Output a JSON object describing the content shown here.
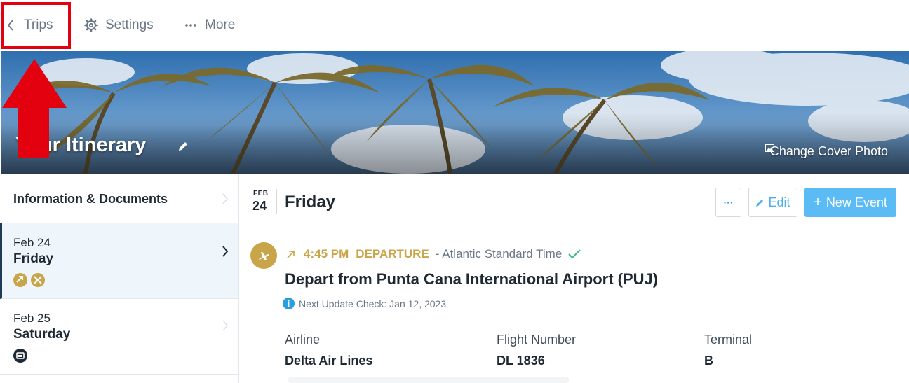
{
  "nav": {
    "back_label": "Trips",
    "settings_label": "Settings",
    "more_label": "More",
    "icons": [
      "chevron-left-icon",
      "gear-icon",
      "ellipsis-icon"
    ]
  },
  "hero": {
    "title": "Your Itinerary",
    "change_cover_label": "Change Cover Photo",
    "icons": [
      "pencil-icon",
      "image-icon"
    ]
  },
  "sidebar": {
    "info_label": "Information & Documents",
    "days": [
      {
        "date": "Feb 24",
        "weekday": "Friday",
        "icons": [
          "flight-icon",
          "flight-icon"
        ],
        "active": true
      },
      {
        "date": "Feb 25",
        "weekday": "Saturday",
        "icons": [
          "lodging-icon"
        ],
        "active": false
      }
    ]
  },
  "main": {
    "date_month": "FEB",
    "date_day": "24",
    "day_title": "Friday",
    "more_button": "···",
    "edit_button": "Edit",
    "new_event_button": "New Event",
    "new_event_plus": "+",
    "event": {
      "time": "4:45 PM",
      "kind": "DEPARTURE",
      "timezone": "- Atlantic Standard Time",
      "title": "Depart from Punta Cana International Airport (PUJ)",
      "update": "Next Update Check: Jan 12, 2023",
      "fields": [
        {
          "label": "Airline",
          "value": "Delta Air Lines"
        },
        {
          "label": "Flight Number",
          "value": "DL 1836"
        },
        {
          "label": "Terminal",
          "value": "B"
        }
      ]
    }
  },
  "colors": {
    "accent": "#5bbcf5",
    "gold": "#c9a54a",
    "annotation_red": "#e3000f",
    "status_green": "#3fbf7f"
  }
}
